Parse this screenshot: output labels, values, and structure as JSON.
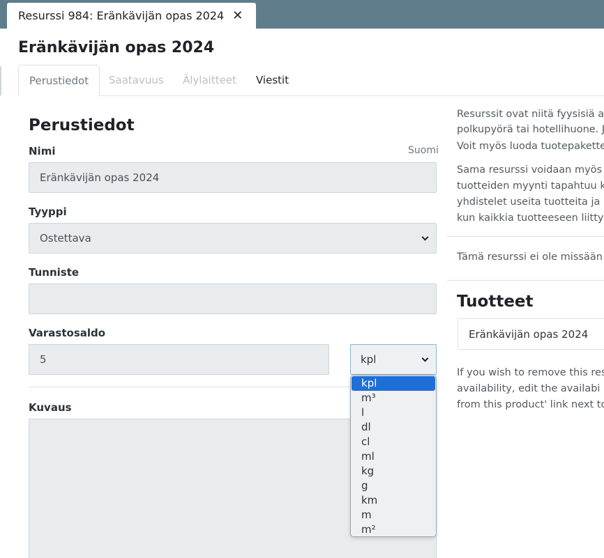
{
  "window_tab": {
    "title": "Resurssi 984: Eränkävijän opas 2024",
    "close": "✕"
  },
  "page_title": "Eränkävijän opas 2024",
  "tabs": [
    {
      "label": "Perustiedot",
      "state": "active"
    },
    {
      "label": "Saatavuus",
      "state": "disabled"
    },
    {
      "label": "Älylaitteet",
      "state": "disabled"
    },
    {
      "label": "Viestit",
      "state": "normal"
    }
  ],
  "form": {
    "section_title": "Perustiedot",
    "name": {
      "label": "Nimi",
      "language": "Suomi",
      "value": "Eränkävijän opas 2024"
    },
    "type": {
      "label": "Tyyppi",
      "value": "Ostettava"
    },
    "identifier": {
      "label": "Tunniste",
      "value": ""
    },
    "stock": {
      "label": "Varastosaldo",
      "value": "5",
      "unit": "kpl",
      "unit_options": [
        "kpl",
        "m³",
        "l",
        "dl",
        "cl",
        "ml",
        "kg",
        "g",
        "km",
        "m",
        "m²"
      ]
    },
    "description": {
      "label": "Kuvaus",
      "value": ""
    }
  },
  "info": {
    "para1": [
      "Resurssit ovat niitä fyysisiä a",
      "polkupyörä tai hotellihuone. J",
      "Voit myös luoda tuotepakette"
    ],
    "para2": [
      "Sama resurssi voidaan myös",
      "tuotteiden myynti tapahtuu k",
      "yhdistelet useita tuotteita ja r",
      "kun kaikkia tuotteeseen liitty"
    ],
    "notice": "Tämä resurssi ei ole missään"
  },
  "products": {
    "title": "Tuotteet",
    "item": "Eränkävijän opas 2024",
    "note": [
      "If you wish to remove this res",
      "availability, edit the availabi",
      "from this product' link next to"
    ]
  },
  "colors": {
    "topbar": "#5f7d8c",
    "selected_option": "#1f6fd6"
  }
}
